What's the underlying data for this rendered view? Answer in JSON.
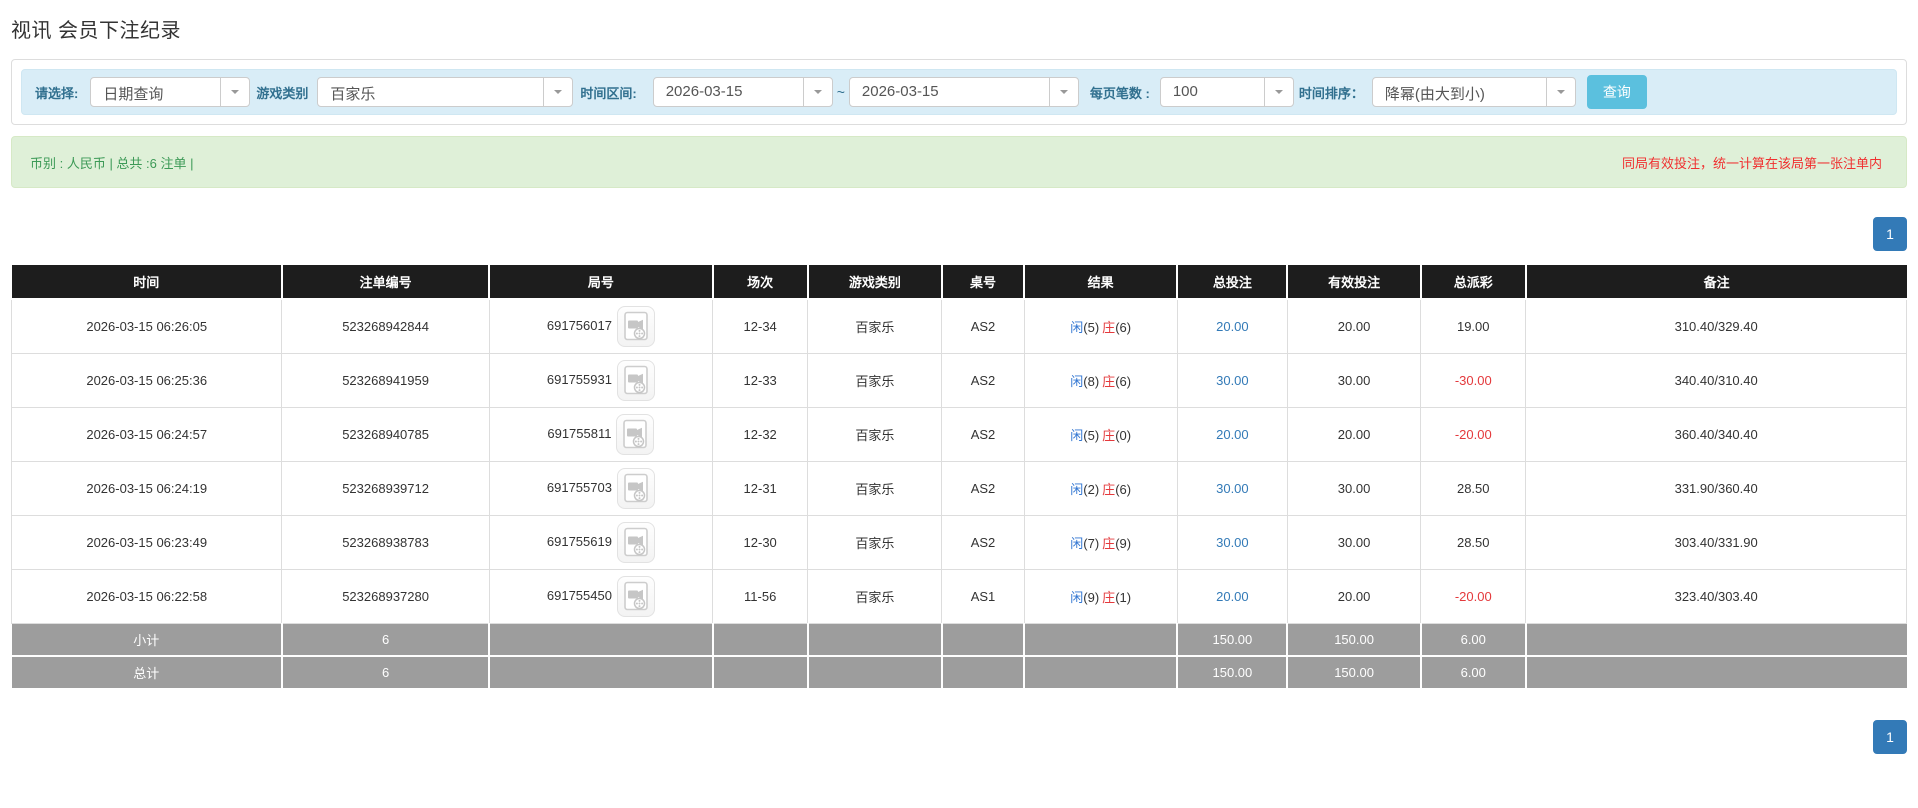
{
  "title": "视讯 会员下注纪录",
  "filters": {
    "select_label": "请选择:",
    "select_value": "日期查询",
    "game_type_label": "游戏类别",
    "game_type_value": "百家乐",
    "time_range_label": "时间区间:",
    "date_from": "2026-03-15",
    "date_separator": "~",
    "date_to": "2026-03-15",
    "page_size_label": "每页笔数 :",
    "page_size_value": "100",
    "sort_label": "时间排序：",
    "sort_value": "降幂(由大到小)",
    "search_button": "查询"
  },
  "summary_bar": {
    "left_text": "币别 : 人民币 | 总共 :6 注单 |",
    "right_note": "同局有效投注，统一计算在该局第一张注单内"
  },
  "pagination": {
    "page": "1"
  },
  "colors": {
    "accent_blue": "#337ab7",
    "link_blue": "#3276d2",
    "red": "#e4393c",
    "search_button_bg": "#5bc0de",
    "filter_bar_bg": "#d9edf7",
    "alert_bg": "#dff0d8",
    "alert_text": "#3d9a57",
    "note_red": "#f03030",
    "header_bg": "#1d1d1d",
    "summary_row_bg": "#9d9d9d"
  },
  "table": {
    "headers": [
      "时间",
      "注单编号",
      "局号",
      "场次",
      "游戏类别",
      "桌号",
      "结果",
      "总投注",
      "有效投注",
      "总派彩",
      "备注"
    ],
    "rows": [
      {
        "time": "2026-03-15 06:26:05",
        "bet_id": "523268942844",
        "round_no": "691756017",
        "session": "12-34",
        "game_type": "百家乐",
        "table_no": "AS2",
        "result_player": "闲",
        "result_player_num": "(5)",
        "result_banker": "庄",
        "result_banker_num": "(6)",
        "total_bet": "20.00",
        "valid_bet": "20.00",
        "payout": "19.00",
        "payout_class": "pos",
        "remark": "310.40/329.40"
      },
      {
        "time": "2026-03-15 06:25:36",
        "bet_id": "523268941959",
        "round_no": "691755931",
        "session": "12-33",
        "game_type": "百家乐",
        "table_no": "AS2",
        "result_player": "闲",
        "result_player_num": "(8)",
        "result_banker": "庄",
        "result_banker_num": "(6)",
        "total_bet": "30.00",
        "valid_bet": "30.00",
        "payout": "-30.00",
        "payout_class": "neg",
        "remark": "340.40/310.40"
      },
      {
        "time": "2026-03-15 06:24:57",
        "bet_id": "523268940785",
        "round_no": "691755811",
        "session": "12-32",
        "game_type": "百家乐",
        "table_no": "AS2",
        "result_player": "闲",
        "result_player_num": "(5)",
        "result_banker": "庄",
        "result_banker_num": "(0)",
        "total_bet": "20.00",
        "valid_bet": "20.00",
        "payout": "-20.00",
        "payout_class": "neg",
        "remark": "360.40/340.40"
      },
      {
        "time": "2026-03-15 06:24:19",
        "bet_id": "523268939712",
        "round_no": "691755703",
        "session": "12-31",
        "game_type": "百家乐",
        "table_no": "AS2",
        "result_player": "闲",
        "result_player_num": "(2)",
        "result_banker": "庄",
        "result_banker_num": "(6)",
        "total_bet": "30.00",
        "valid_bet": "30.00",
        "payout": "28.50",
        "payout_class": "pos",
        "remark": "331.90/360.40"
      },
      {
        "time": "2026-03-15 06:23:49",
        "bet_id": "523268938783",
        "round_no": "691755619",
        "session": "12-30",
        "game_type": "百家乐",
        "table_no": "AS2",
        "result_player": "闲",
        "result_player_num": "(7)",
        "result_banker": "庄",
        "result_banker_num": "(9)",
        "total_bet": "30.00",
        "valid_bet": "30.00",
        "payout": "28.50",
        "payout_class": "pos",
        "remark": "303.40/331.90"
      },
      {
        "time": "2026-03-15 06:22:58",
        "bet_id": "523268937280",
        "round_no": "691755450",
        "session": "11-56",
        "game_type": "百家乐",
        "table_no": "AS1",
        "result_player": "闲",
        "result_player_num": "(9)",
        "result_banker": "庄",
        "result_banker_num": "(1)",
        "total_bet": "20.00",
        "valid_bet": "20.00",
        "payout": "-20.00",
        "payout_class": "neg",
        "remark": "323.40/303.40"
      }
    ],
    "subtotal": {
      "label": "小计",
      "count": "6",
      "total_bet": "150.00",
      "valid_bet": "150.00",
      "payout": "6.00"
    },
    "total": {
      "label": "总计",
      "count": "6",
      "total_bet": "150.00",
      "valid_bet": "150.00",
      "payout": "6.00"
    }
  }
}
